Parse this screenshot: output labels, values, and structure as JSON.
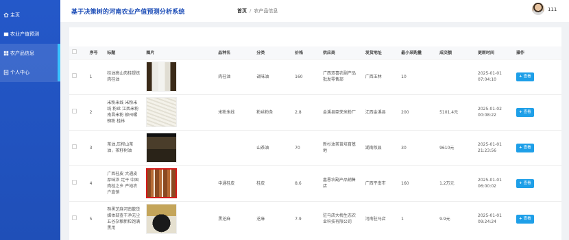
{
  "header": {
    "title": "基于决策树的河南农业产值预测分析系统",
    "breadcrumb": {
      "home": "首页",
      "current": "农产品信息"
    },
    "user_name": "111"
  },
  "sidebar": {
    "items": [
      {
        "label": "主页",
        "icon": "home-icon"
      },
      {
        "label": "农业产值预测",
        "icon": "chart-icon"
      },
      {
        "label": "农产品信息",
        "icon": "grid-icon"
      },
      {
        "label": "个人中心",
        "icon": "document-icon"
      }
    ],
    "active_index": 2
  },
  "table": {
    "headers": [
      "序号",
      "标题",
      "图片",
      "品种名",
      "分类",
      "价格",
      "供应商",
      "发货地址",
      "最小采购量",
      "成交额",
      "更新时间",
      "操作"
    ],
    "view_label": "查看",
    "rows": [
      {
        "index": "1",
        "title": "桂油高山肉桂提炼肉桂油",
        "variety": "肉桂油",
        "category": "调味油",
        "price": "160",
        "supplier": "广西双喜农副产品批发零售部",
        "address": "广西玉林",
        "min_qty": "10",
        "turnover": "",
        "updated": "2025-01-01 07:04:10",
        "img": "oil"
      },
      {
        "index": "2",
        "title": "米粉米线 米粉米线 粉丝 江西米粉 南昌米粉 柳州螺蛳粉 桂林",
        "variety": "米粉米线",
        "category": "粉丝粉条",
        "price": "2.8",
        "supplier": "金溪县臣荣米粉厂",
        "address": "江西金溪县",
        "min_qty": "200",
        "turnover": "5101.4元",
        "updated": "2025-01-02 00:08:22",
        "img": "noodle"
      },
      {
        "index": "3",
        "title": "茶油,压榨山茶油，茶籽树油",
        "variety": "",
        "category": "山茶油",
        "price": "70",
        "supplier": "新杉油茶苗培育基地",
        "address": "湖南攸县",
        "min_qty": "30",
        "turnover": "9610元",
        "updated": "2025-01-01 21:23:56",
        "img": "tree"
      },
      {
        "index": "4",
        "title": "广西桂皮 大通皮厚味浓 足干 中国肉桂之乡 产地农户直销",
        "variety": "中通桂皮",
        "category": "桂皮",
        "price": "8.6",
        "supplier": "嘉恩农副产品销售店",
        "address": "广西平南市",
        "min_qty": "160",
        "turnover": "1.2万元",
        "updated": "2025-01-01 06:00:02",
        "img": "cinnamon"
      },
      {
        "index": "5",
        "title": "熟黑芝麻河南散货媒体部查干净无尘五谷杂粮新粒饱满黑用",
        "variety": "黑芝麻",
        "category": "芝麻",
        "price": "7.9",
        "supplier": "驻马店大梅生态农业科技有限公司",
        "address": "河南驻马店",
        "min_qty": "1",
        "turnover": "9.9元",
        "updated": "2025-01-01 09:24:24",
        "img": "sesame"
      }
    ]
  },
  "colors": {
    "sidebar": "#2458c9",
    "accent": "#1e9fe8",
    "title": "#1f4fb8"
  }
}
